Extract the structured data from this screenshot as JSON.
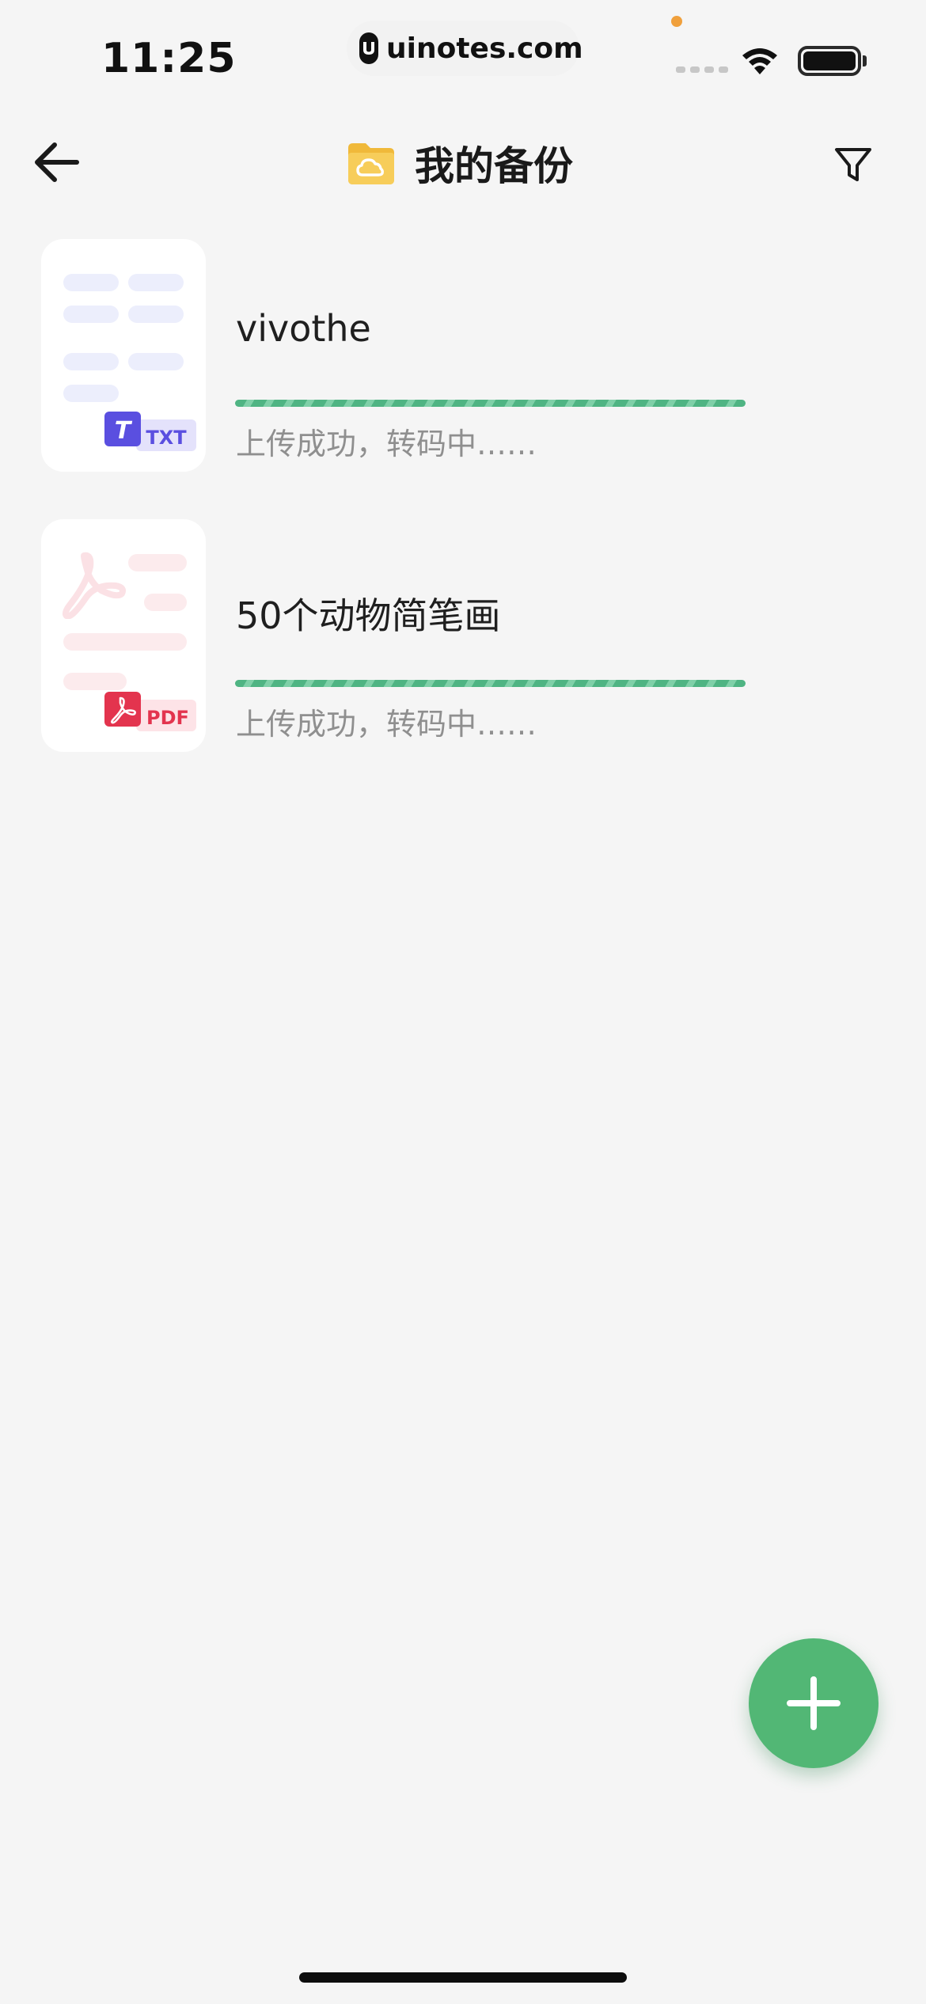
{
  "status_bar": {
    "time": "11:25",
    "site": "uinotes.com"
  },
  "header": {
    "title": "我的备份"
  },
  "files": [
    {
      "name": "vivothe",
      "status": "上传成功，转码中……",
      "type_label": "TXT",
      "progress": 1.0
    },
    {
      "name": "50个动物简笔画",
      "status": "上传成功，转码中……",
      "type_label": "PDF",
      "progress": 1.0
    }
  ],
  "colors": {
    "accent_green": "#52b775",
    "progress_green": "#4fb483",
    "txt_purple": "#5a4fe0",
    "pdf_red": "#e3344e",
    "folder_yellow": "#f5c54d"
  },
  "icons": {
    "back": "arrow-left-icon",
    "folder": "cloud-folder-icon",
    "filter": "funnel-icon",
    "add": "plus-icon"
  }
}
